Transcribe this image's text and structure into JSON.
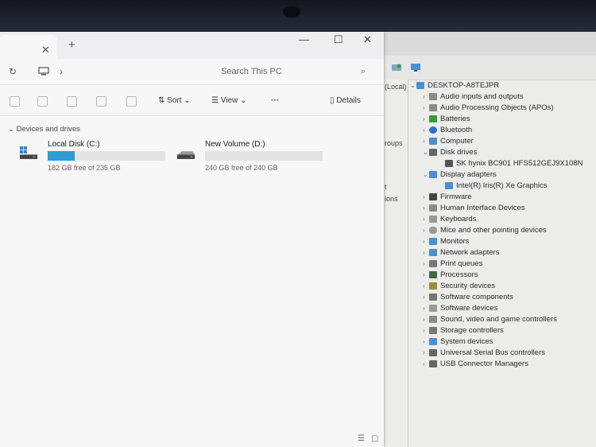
{
  "explorer": {
    "tab_close": "✕",
    "new_tab": "+",
    "window_controls": {
      "minimize": "—",
      "maximize": "☐",
      "close": "✕"
    },
    "address": {
      "refresh": "↻",
      "location_icon": "pc-icon",
      "chevron": "›"
    },
    "search": {
      "placeholder": "Search This PC"
    },
    "toolbar": {
      "sort_label": "Sort",
      "view_label": "View",
      "more_label": "···",
      "details_label": "Details"
    },
    "group_label": "Devices and drives",
    "drives": [
      {
        "name": "Local Disk (C:)",
        "free": "182 GB free of 235 GB",
        "used_fraction": 0.23
      },
      {
        "name": "New Volume (D:)",
        "free": "240 GB free of 240 GB",
        "used_fraction": 0.0
      }
    ],
    "colors": {
      "accent": "#2e9bd6"
    }
  },
  "background_window": {
    "left_pane": [
      "(Local)",
      "roups",
      "t",
      "ions"
    ]
  },
  "device_manager": {
    "root": "DESKTOP-A8TEJPR",
    "categories": [
      "Audio inputs and outputs",
      "Audio Processing Objects (APOs)",
      "Batteries",
      "Bluetooth",
      "Computer",
      "Disk drives",
      "SK hynix BC901 HFS512GEJ9X108N",
      "Display adapters",
      "Intel(R) Iris(R) Xe Graphics",
      "Firmware",
      "Human Interface Devices",
      "Keyboards",
      "Mice and other pointing devices",
      "Monitors",
      "Network adapters",
      "Print queues",
      "Processors",
      "Security devices",
      "Software components",
      "Software devices",
      "Sound, video and game controllers",
      "Storage controllers",
      "System devices",
      "Universal Serial Bus controllers",
      "USB Connector Managers"
    ]
  }
}
